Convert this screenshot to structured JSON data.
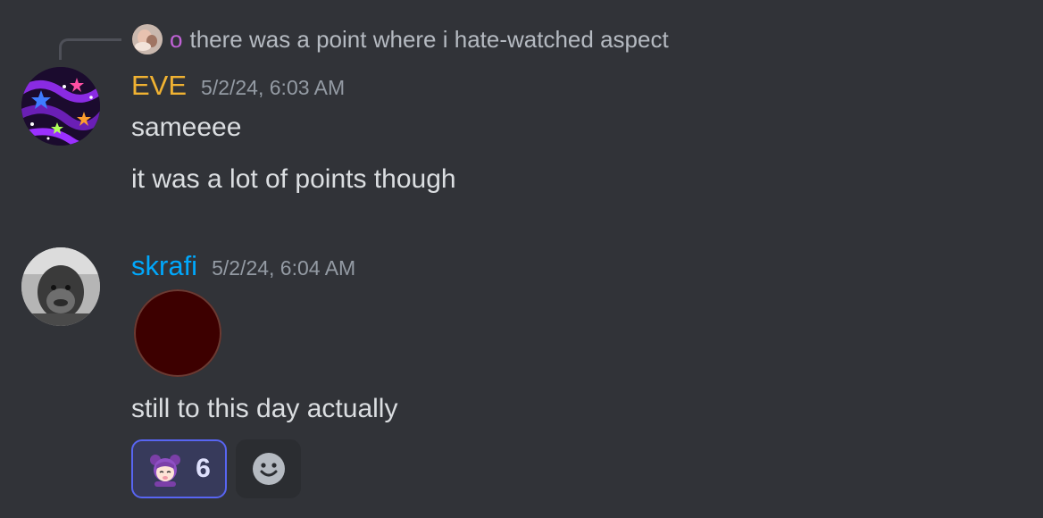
{
  "reply": {
    "author": "o",
    "text": "there was a point where i hate-watched aspect"
  },
  "messages": [
    {
      "author": "EVE",
      "author_color": "#f0b232",
      "timestamp": "5/2/24, 6:03 AM",
      "lines": [
        "sameeee",
        "it was a lot of points though"
      ]
    },
    {
      "author": "skrafi",
      "author_color": "#00a8fc",
      "timestamp": "5/2/24, 6:04 AM",
      "lines": [
        "still to this day actually"
      ]
    }
  ],
  "reaction": {
    "emoji_icon": "anime-girl-emoji",
    "count": "6"
  },
  "add_reaction_icon": "smiley-face-icon"
}
